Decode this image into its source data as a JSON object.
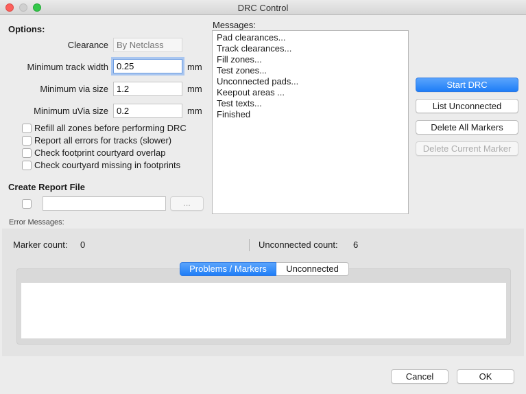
{
  "window": {
    "title": "DRC Control"
  },
  "options": {
    "heading": "Options:",
    "clearance": {
      "label": "Clearance",
      "placeholder": "By Netclass"
    },
    "min_track": {
      "label": "Minimum track width",
      "value": "0.25",
      "unit": "mm"
    },
    "min_via": {
      "label": "Minimum via size",
      "value": "1.2",
      "unit": "mm"
    },
    "min_uvia": {
      "label": "Minimum uVia size",
      "value": "0.2",
      "unit": "mm"
    },
    "checkboxes": [
      {
        "label": "Refill all zones before performing DRC",
        "checked": false
      },
      {
        "label": "Report all errors for tracks (slower)",
        "checked": false
      },
      {
        "label": "Check footprint courtyard overlap",
        "checked": false
      },
      {
        "label": "Check courtyard missing in footprints",
        "checked": false
      }
    ]
  },
  "report": {
    "heading": "Create Report File",
    "path": "",
    "browse_label": "..."
  },
  "messages": {
    "label": "Messages:",
    "lines": [
      "Pad clearances...",
      "Track clearances...",
      "Fill zones...",
      "Test zones...",
      "Unconnected pads...",
      "Keepout areas ...",
      "Test texts...",
      "Finished"
    ]
  },
  "actions": {
    "start_drc": "Start DRC",
    "list_unconnected": "List Unconnected",
    "delete_all_markers": "Delete All Markers",
    "delete_current_marker": "Delete Current Marker"
  },
  "errors": {
    "label": "Error Messages:",
    "marker_count_label": "Marker count:",
    "marker_count": "0",
    "unconnected_count_label": "Unconnected count:",
    "unconnected_count": "6",
    "tabs": [
      "Problems / Markers",
      "Unconnected"
    ],
    "active_tab": "Problems / Markers"
  },
  "footer": {
    "cancel": "Cancel",
    "ok": "OK"
  },
  "colors": {
    "accent": "#1f7ef7",
    "focus_ring": "#a9c6f0",
    "window_bg": "#ececec"
  }
}
